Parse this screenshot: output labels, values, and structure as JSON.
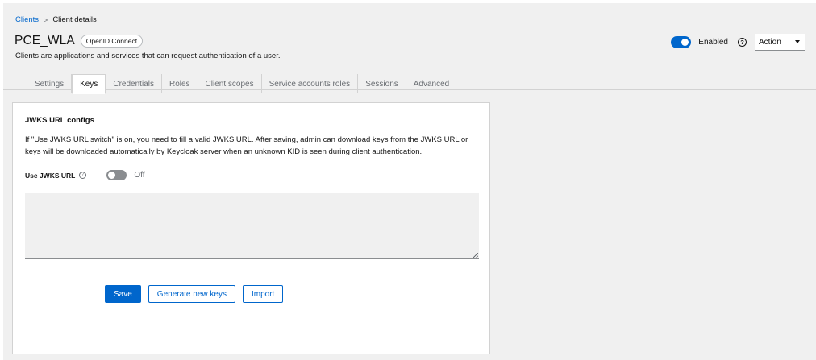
{
  "breadcrumb": {
    "parent": "Clients",
    "separator": ">",
    "current": "Client details"
  },
  "header": {
    "title": "PCE_WLA",
    "protocol_badge": "OpenID Connect",
    "subtitle": "Clients are applications and services that can request authentication of a user.",
    "enabled_label": "Enabled",
    "enabled": true,
    "help_glyph": "?",
    "action_label": "Action"
  },
  "tabs": [
    {
      "label": "Settings",
      "active": false
    },
    {
      "label": "Keys",
      "active": true
    },
    {
      "label": "Credentials",
      "active": false
    },
    {
      "label": "Roles",
      "active": false
    },
    {
      "label": "Client scopes",
      "active": false
    },
    {
      "label": "Service accounts roles",
      "active": false
    },
    {
      "label": "Sessions",
      "active": false
    },
    {
      "label": "Advanced",
      "active": false
    }
  ],
  "jwks": {
    "title": "JWKS URL configs",
    "description": "If \"Use JWKS URL switch\" is on, you need to fill a valid JWKS URL. After saving, admin can download keys from the JWKS URL or keys will be downloaded automatically by Keycloak server when an unknown KID is seen during client authentication.",
    "use_label": "Use JWKS URL",
    "help_glyph": "?",
    "toggle_state": "Off",
    "toggle_on": false,
    "textarea_value": ""
  },
  "buttons": {
    "save": "Save",
    "generate": "Generate new keys",
    "import": "Import"
  },
  "colors": {
    "accent": "#0066cc",
    "background": "#f0f0f0",
    "toggle_off": "#8a8d90"
  },
  "icons": {
    "help": "help-icon",
    "caret": "caret-down-icon",
    "resize": "resize-grip-icon"
  }
}
